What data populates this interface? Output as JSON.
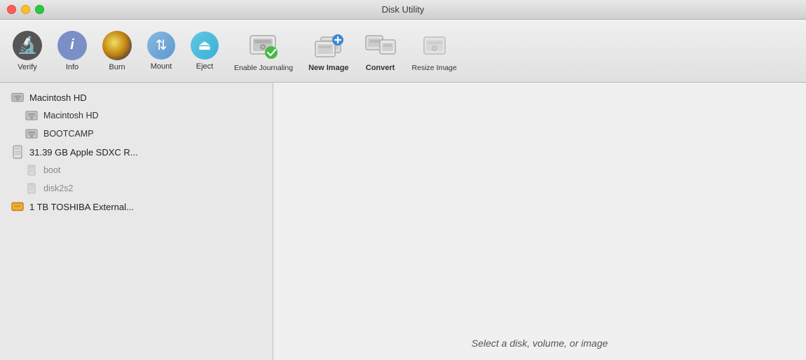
{
  "window": {
    "title": "Disk Utility"
  },
  "titlebar": {
    "buttons": {
      "close_label": "close",
      "minimize_label": "minimize",
      "maximize_label": "maximize"
    }
  },
  "toolbar": {
    "items": [
      {
        "id": "verify",
        "label": "Verify",
        "bold": false
      },
      {
        "id": "info",
        "label": "Info",
        "bold": false
      },
      {
        "id": "burn",
        "label": "Burn",
        "bold": false
      },
      {
        "id": "mount",
        "label": "Mount",
        "bold": false
      },
      {
        "id": "eject",
        "label": "Eject",
        "bold": false
      },
      {
        "id": "enable-journaling",
        "label": "Enable Journaling",
        "bold": false
      },
      {
        "id": "new-image",
        "label": "New Image",
        "bold": true
      },
      {
        "id": "convert",
        "label": "Convert",
        "bold": true
      },
      {
        "id": "resize-image",
        "label": "Resize Image",
        "bold": false
      }
    ]
  },
  "sidebar": {
    "items": [
      {
        "id": "macintosh-hd-disk",
        "label": "Macintosh HD",
        "level": 1,
        "icon": "hd",
        "dimmed": false
      },
      {
        "id": "macintosh-hd-vol",
        "label": "Macintosh HD",
        "level": 2,
        "icon": "hd-small",
        "dimmed": false
      },
      {
        "id": "bootcamp",
        "label": "BOOTCAMP",
        "level": 2,
        "icon": "hd-small",
        "dimmed": false
      },
      {
        "id": "sdxc-reader",
        "label": "31.39 GB Apple SDXC R...",
        "level": 1,
        "icon": "sd",
        "dimmed": false
      },
      {
        "id": "boot",
        "label": "boot",
        "level": 2,
        "icon": "sd-small",
        "dimmed": true
      },
      {
        "id": "disk2s2",
        "label": "disk2s2",
        "level": 2,
        "icon": "sd-small",
        "dimmed": true
      },
      {
        "id": "toshiba-ext",
        "label": "1 TB TOSHIBA External...",
        "level": 1,
        "icon": "usb",
        "dimmed": false
      }
    ]
  },
  "detail": {
    "hint": "Select a disk, volume, or image"
  }
}
